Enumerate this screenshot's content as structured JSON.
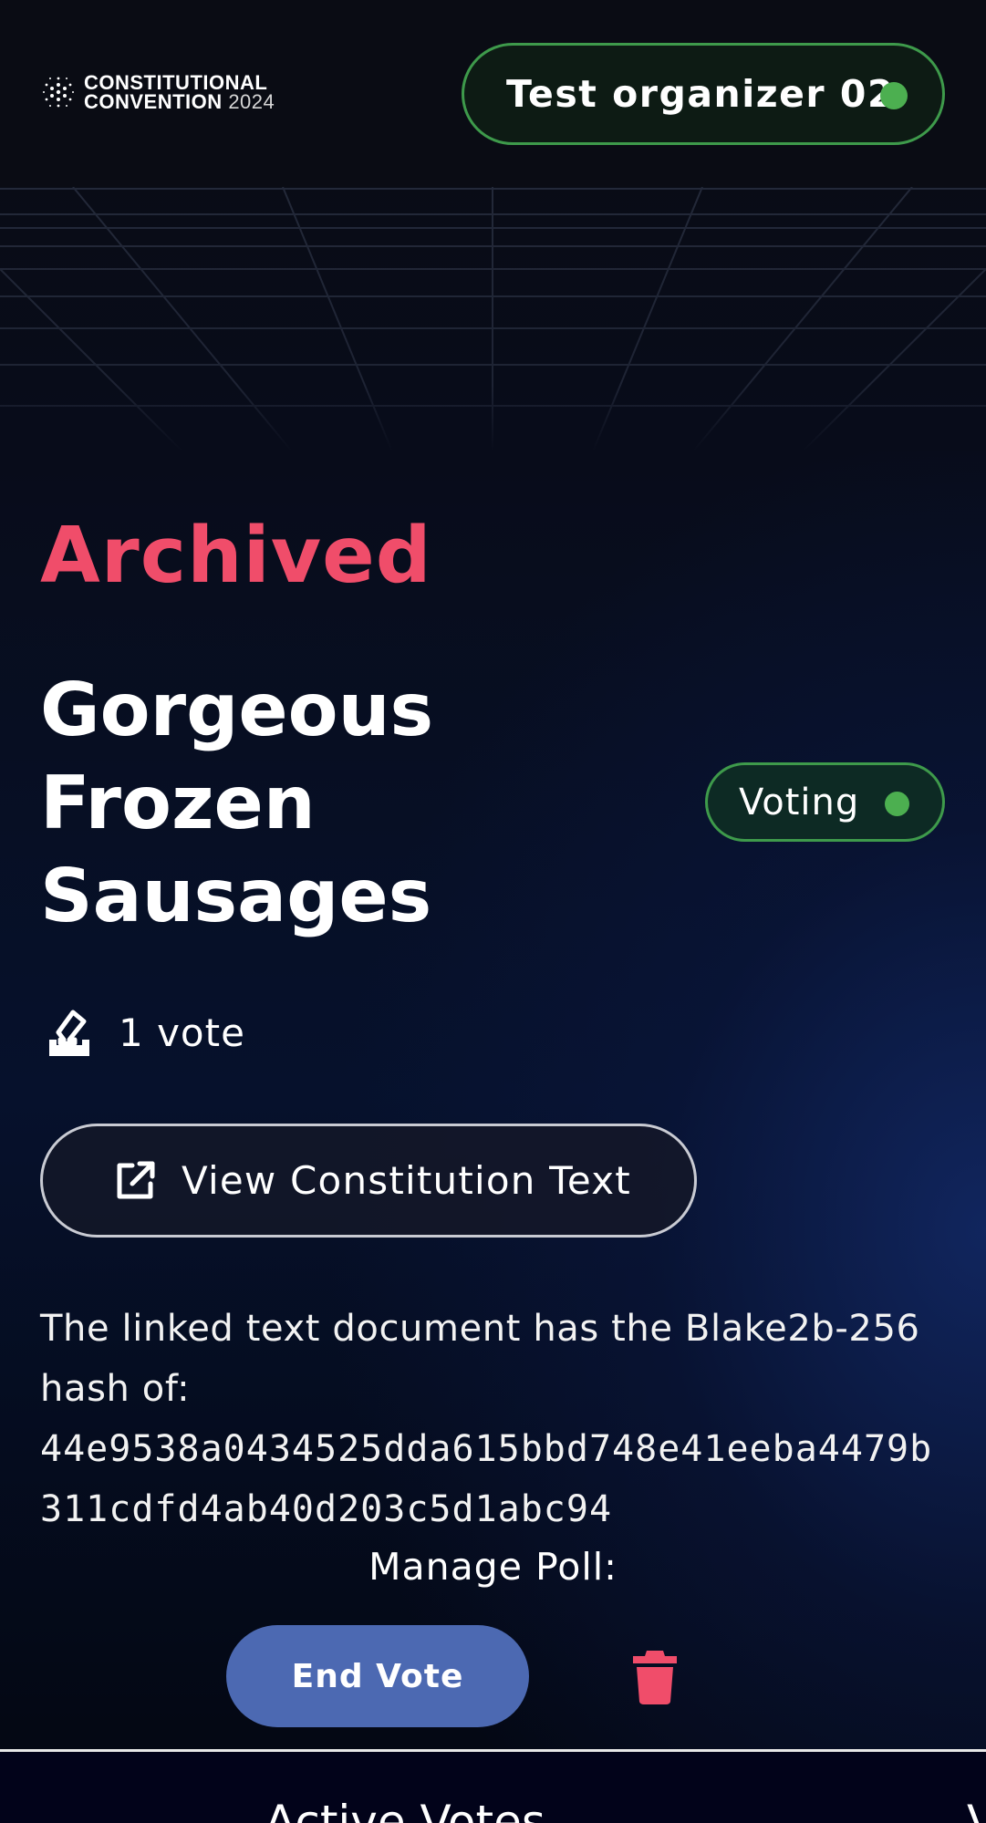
{
  "header": {
    "logo": {
      "line1": "CONSTITUTIONAL",
      "line2": "CONVENTION",
      "year": "2024"
    },
    "user": {
      "name": "Test organizer 02",
      "status_color": "#4caf50"
    }
  },
  "poll": {
    "status": "Archived",
    "title": "Gorgeous Frozen Sausages",
    "phase_badge": "Voting",
    "vote_count": "1 vote",
    "view_button": "View Constitution Text",
    "hash_intro": "The linked text document has the Blake2b-256 hash of:",
    "hash": "44e9538a0434525dda615bbd748e41eeba4479b311cdfd4ab40d203c5d1abc94"
  },
  "manage": {
    "label": "Manage Poll:",
    "end_vote": "End Vote"
  },
  "bottom_tabs": {
    "active": "Active Votes",
    "next": "V"
  },
  "colors": {
    "archived": "#f04d6a",
    "accent_green": "#4caf50",
    "end_vote_bg": "#4c69b2",
    "delete": "#f04d6a"
  },
  "icons": {
    "logo": "cardano-star-icon",
    "vote": "ballot-box-icon",
    "external": "external-link-icon",
    "delete": "trash-icon"
  }
}
